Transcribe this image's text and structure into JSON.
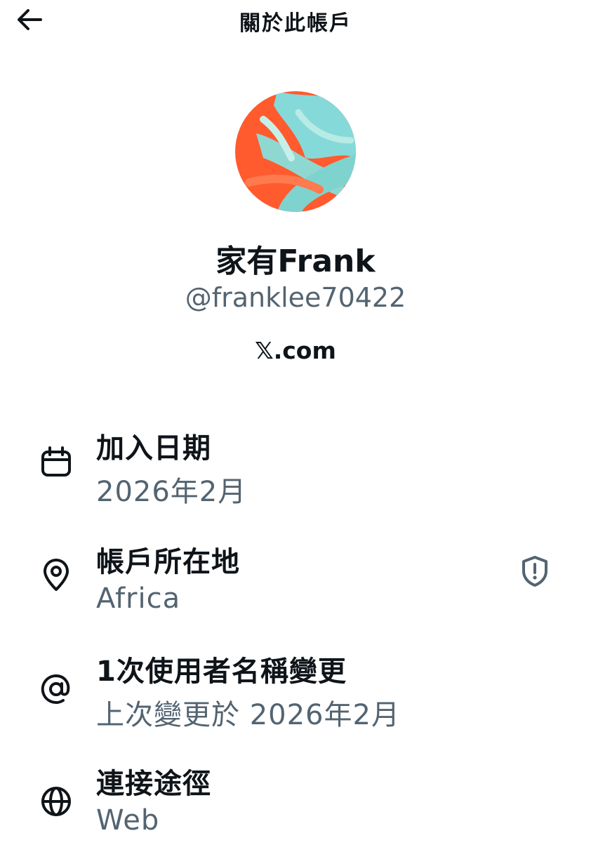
{
  "header": {
    "title": "關於此帳戶",
    "back_icon": "arrow-left-icon"
  },
  "profile": {
    "display_name": "家有Frank",
    "handle": "@franklee70422",
    "site_badge": "𝕏.com",
    "avatar_colors": [
      "#ff5b2e",
      "#86d9d9"
    ]
  },
  "rows": [
    {
      "icon": "calendar-icon",
      "title": "加入日期",
      "subtitle": "2026年2月"
    },
    {
      "icon": "location-pin-icon",
      "title": "帳戶所在地",
      "subtitle": "Africa",
      "trailing_icon": "shield-alert-icon"
    },
    {
      "icon": "at-sign-icon",
      "title": "1次使用者名稱變更",
      "subtitle": "上次變更於 2026年2月"
    },
    {
      "icon": "globe-icon",
      "title": "連接途徑",
      "subtitle": "Web"
    }
  ],
  "colors": {
    "text_primary": "#0f1419",
    "text_secondary": "#536471"
  }
}
